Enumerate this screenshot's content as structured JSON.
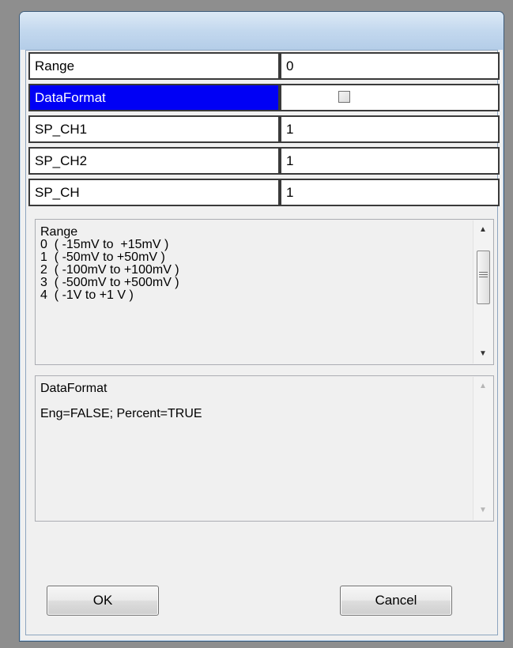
{
  "properties": [
    {
      "label": "Range",
      "value": "0"
    },
    {
      "label": "DataFormat",
      "value": "",
      "type": "checkbox",
      "checked": false,
      "selected": true
    },
    {
      "label": "SP_CH1",
      "value": "1"
    },
    {
      "label": "SP_CH2",
      "value": "1"
    },
    {
      "label": "SP_CH",
      "value": "1"
    }
  ],
  "description_box": {
    "lines": [
      "Range",
      "0  ( -15mV to  +15mV )",
      "1  ( -50mV to +50mV )",
      "2  ( -100mV to +100mV )",
      "3  ( -500mV to +500mV )",
      "4  ( -1V to +1 V )"
    ]
  },
  "info_box": {
    "lines": [
      "DataFormat",
      "",
      "Eng=FALSE; Percent=TRUE"
    ]
  },
  "buttons": {
    "ok": "OK",
    "cancel": "Cancel"
  },
  "colors": {
    "selection": "#0000f5",
    "window_border": "#3c5a78",
    "background": "#f0f0f0"
  }
}
